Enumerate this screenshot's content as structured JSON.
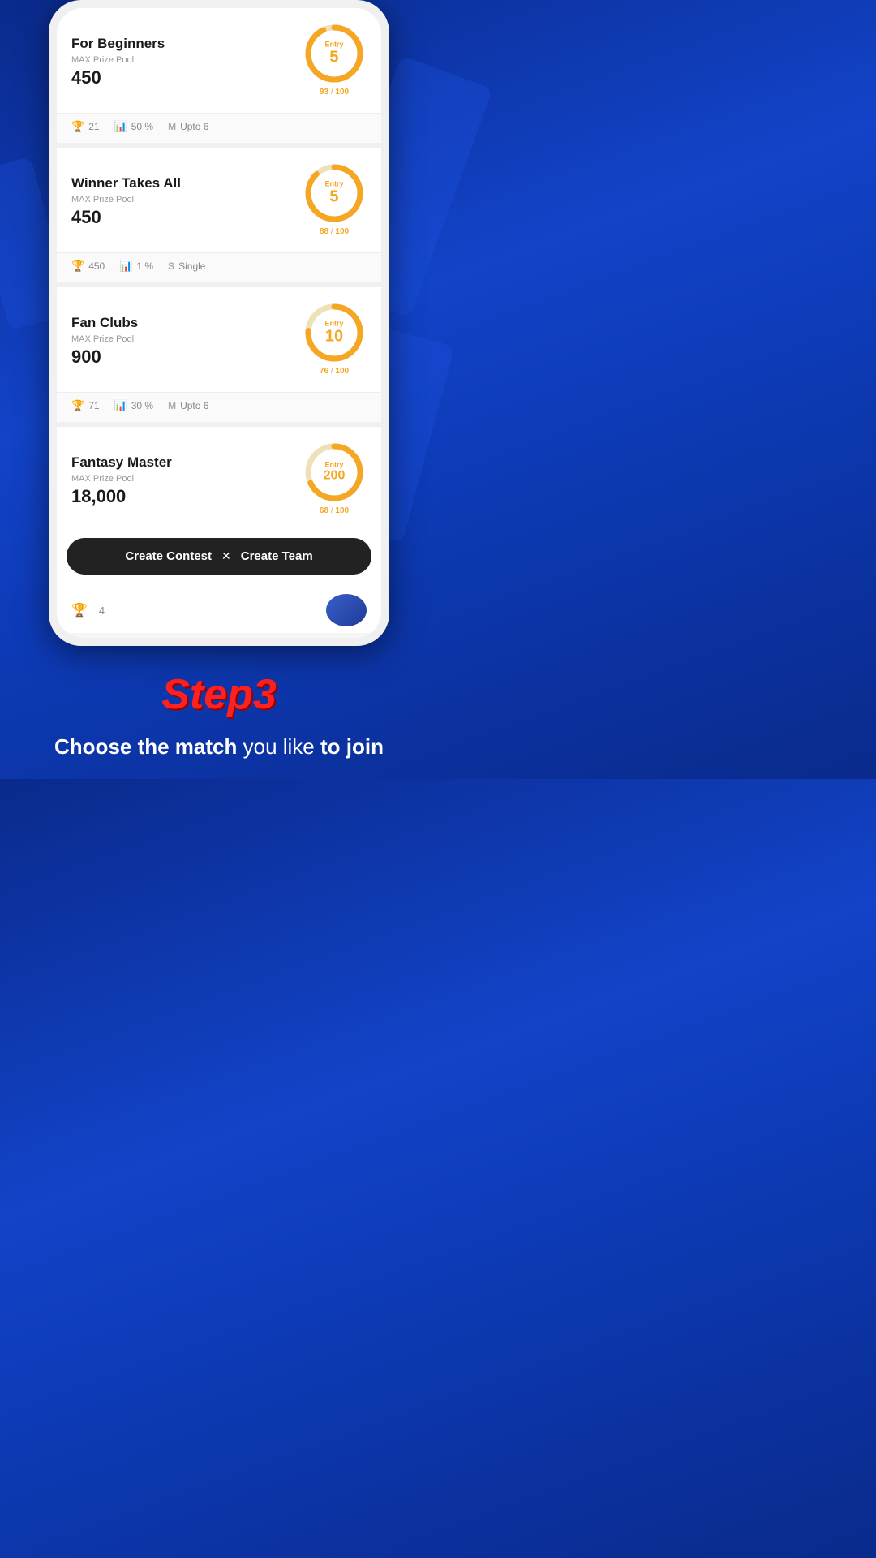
{
  "background": {
    "colors": [
      "#0a2a8c",
      "#1243c8",
      "#0d3ab5"
    ]
  },
  "contests": [
    {
      "id": "for-beginners",
      "title": "For Beginners",
      "prize_label": "MAX Prize Pool",
      "prize": "450",
      "entry_label": "Entry",
      "entry_amount": "5",
      "filled": 93,
      "total": 100,
      "progress_text": "93",
      "progress_total": "100",
      "stats": [
        {
          "icon": "🏆",
          "value": "21"
        },
        {
          "icon": "📊",
          "value": "50 %"
        },
        {
          "icon": "M",
          "value": "Upto 6"
        }
      ]
    },
    {
      "id": "winner-takes-all",
      "title": "Winner Takes All",
      "prize_label": "MAX Prize Pool",
      "prize": "450",
      "entry_label": "Entry",
      "entry_amount": "5",
      "filled": 88,
      "total": 100,
      "progress_text": "88",
      "progress_total": "100",
      "stats": [
        {
          "icon": "🏆",
          "value": "450"
        },
        {
          "icon": "📊",
          "value": "1 %"
        },
        {
          "icon": "S",
          "value": "Single"
        }
      ]
    },
    {
      "id": "fan-clubs",
      "title": "Fan Clubs",
      "prize_label": "MAX Prize Pool",
      "prize": "900",
      "entry_label": "Entry",
      "entry_amount": "10",
      "filled": 76,
      "total": 100,
      "progress_text": "76",
      "progress_total": "100",
      "stats": [
        {
          "icon": "🏆",
          "value": "71"
        },
        {
          "icon": "📊",
          "value": "30 %"
        },
        {
          "icon": "M",
          "value": "Upto 6"
        }
      ]
    },
    {
      "id": "fantasy-master",
      "title": "Fantasy Master",
      "prize_label": "MAX Prize Pool",
      "prize": "18,000",
      "entry_label": "Entry",
      "entry_amount": "200",
      "filled": 68,
      "total": 100,
      "progress_text": "68",
      "progress_total": "100",
      "stats": [
        {
          "icon": "🏆",
          "value": "4"
        },
        {
          "icon": "📊",
          "value": ""
        },
        {
          "icon": "",
          "value": ""
        }
      ]
    }
  ],
  "action_bar": {
    "create_contest": "Create Contest",
    "separator": "✕",
    "create_team": "Create Team"
  },
  "bottom": {
    "step_title": "Step3",
    "description_bold1": "Choose the match",
    "description_regular": " you like ",
    "description_bold2": "to join"
  }
}
